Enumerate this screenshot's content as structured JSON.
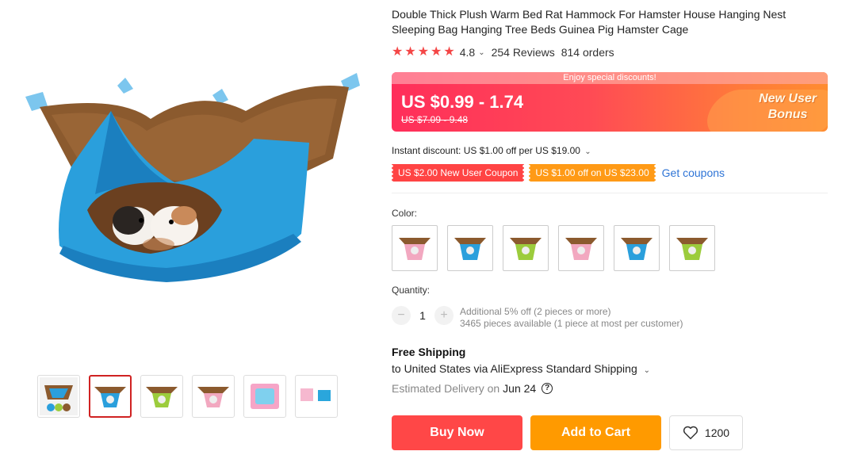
{
  "product": {
    "title": "Double Thick Plush Warm Bed Rat Hammock For Hamster House Hanging Nest Sleeping Bag Hanging Tree Beds Guinea Pig Hamster Cage",
    "rating_stars": 5,
    "rating_value": "4.8",
    "reviews": "254 Reviews",
    "orders": "814 orders"
  },
  "price": {
    "banner_top": "Enjoy special discounts!",
    "current": "US $0.99 - 1.74",
    "original": "US $7.09 - 9.48",
    "bonus_line1": "New User",
    "bonus_line2": "Bonus"
  },
  "discounts": {
    "instant": "Instant discount: US $1.00 off per US $19.00",
    "coupon_red": "US $2.00 New User Coupon",
    "coupon_orange": "US $1.00 off on US $23.00",
    "get_coupons": "Get coupons"
  },
  "color": {
    "label": "Color:",
    "options": [
      "pink-brown",
      "blue-brown",
      "green-brown",
      "pink-brown",
      "blue-brown",
      "green-brown"
    ]
  },
  "quantity": {
    "label": "Quantity:",
    "minus": "−",
    "value": "1",
    "plus": "+",
    "info_line1": "Additional 5% off (2 pieces or more)",
    "info_line2": "3465 pieces available (1 piece at most per customer)"
  },
  "shipping": {
    "title": "Free Shipping",
    "via": "to United States via AliExpress Standard Shipping",
    "delivery_label": "Estimated Delivery on",
    "delivery_date": "Jun 24"
  },
  "actions": {
    "buy_now": "Buy Now",
    "add_to_cart": "Add to Cart",
    "wishlist_count": "1200"
  },
  "colors": {
    "accent_red": "#ff4747",
    "accent_orange": "#ff9a00",
    "star": "#f44646",
    "link": "#2e74d6"
  }
}
